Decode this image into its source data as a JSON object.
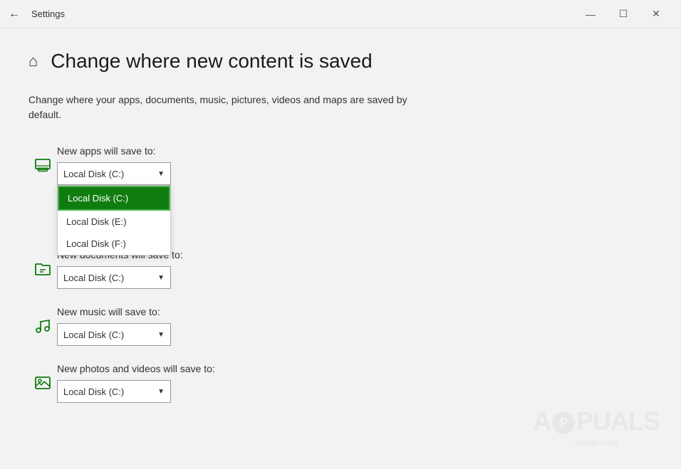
{
  "titleBar": {
    "title": "Settings",
    "backLabel": "←",
    "minimizeLabel": "—",
    "maximizeLabel": "☐",
    "closeLabel": "✕"
  },
  "pageHeader": {
    "homeIcon": "⌂",
    "title": "Change where new content is saved"
  },
  "description": "Change where your apps, documents, music, pictures, videos and maps are saved by default.",
  "sections": [
    {
      "id": "apps",
      "label": "New apps will save to:",
      "icon": "apps",
      "selectedValue": "Local Disk (C:)",
      "showDropdown": true,
      "dropdownOptions": [
        {
          "value": "Local Disk (C:)",
          "selected": true
        },
        {
          "value": "Local Disk (E:)",
          "selected": false
        },
        {
          "value": "Local Disk (F:)",
          "selected": false
        }
      ]
    },
    {
      "id": "documents",
      "label": "New documents will save to:",
      "icon": "folder",
      "selectedValue": "Local Disk (C:)",
      "showDropdown": false
    },
    {
      "id": "music",
      "label": "New music will save to:",
      "icon": "music",
      "selectedValue": "Local Disk (C:)",
      "showDropdown": false
    },
    {
      "id": "photos",
      "label": "New photos and videos will save to:",
      "icon": "photo",
      "selectedValue": "Local Disk (C:)",
      "showDropdown": false
    }
  ],
  "watermark": {
    "site": "wsxdn.com"
  }
}
